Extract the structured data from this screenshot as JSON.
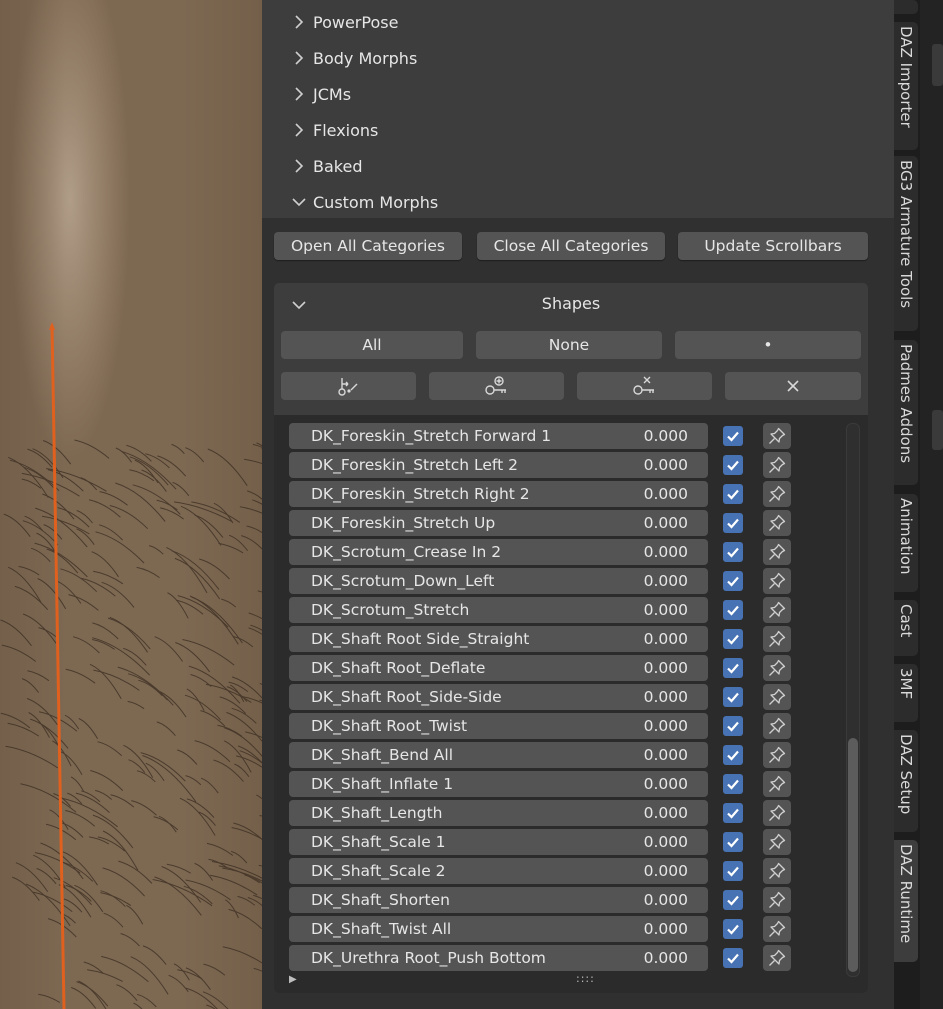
{
  "categories": [
    {
      "label": "PowerPose",
      "expanded": false
    },
    {
      "label": "Body Morphs",
      "expanded": false
    },
    {
      "label": "JCMs",
      "expanded": false
    },
    {
      "label": "Flexions",
      "expanded": false
    },
    {
      "label": "Baked",
      "expanded": false
    },
    {
      "label": "Custom Morphs",
      "expanded": true
    }
  ],
  "actions": {
    "open_all": "Open All Categories",
    "close_all": "Close All Categories",
    "update_scrollbars": "Update Scrollbars"
  },
  "shapes": {
    "title": "Shapes",
    "all_label": "All",
    "none_label": "None",
    "dot_label": "•",
    "tool_icons": [
      "add-driver-icon",
      "add-key-icon",
      "remove-key-icon",
      "clear-icon"
    ],
    "items": [
      {
        "name": "DK_Foreskin_Stretch Forward 1",
        "value": "0.000",
        "checked": true
      },
      {
        "name": "DK_Foreskin_Stretch Left 2",
        "value": "0.000",
        "checked": true
      },
      {
        "name": "DK_Foreskin_Stretch Right 2",
        "value": "0.000",
        "checked": true
      },
      {
        "name": "DK_Foreskin_Stretch Up",
        "value": "0.000",
        "checked": true
      },
      {
        "name": "DK_Scrotum_Crease In 2",
        "value": "0.000",
        "checked": true
      },
      {
        "name": "DK_Scrotum_Down_Left",
        "value": "0.000",
        "checked": true
      },
      {
        "name": "DK_Scrotum_Stretch",
        "value": "0.000",
        "checked": true
      },
      {
        "name": "DK_Shaft Root Side_Straight",
        "value": "0.000",
        "checked": true
      },
      {
        "name": "DK_Shaft Root_Deflate",
        "value": "0.000",
        "checked": true
      },
      {
        "name": "DK_Shaft Root_Side-Side",
        "value": "0.000",
        "checked": true
      },
      {
        "name": "DK_Shaft Root_Twist",
        "value": "0.000",
        "checked": true
      },
      {
        "name": "DK_Shaft_Bend All",
        "value": "0.000",
        "checked": true
      },
      {
        "name": "DK_Shaft_Inflate 1",
        "value": "0.000",
        "checked": true
      },
      {
        "name": "DK_Shaft_Length",
        "value": "0.000",
        "checked": true
      },
      {
        "name": "DK_Shaft_Scale 1",
        "value": "0.000",
        "checked": true
      },
      {
        "name": "DK_Shaft_Scale 2",
        "value": "0.000",
        "checked": true
      },
      {
        "name": "DK_Shaft_Shorten",
        "value": "0.000",
        "checked": true
      },
      {
        "name": "DK_Shaft_Twist All",
        "value": "0.000",
        "checked": true
      },
      {
        "name": "DK_Urethra Root_Push Bottom",
        "value": "0.000",
        "checked": true
      }
    ],
    "footer_grip": "::::"
  },
  "sidebar_tabs": [
    {
      "label": "DAZ Importer",
      "active": false
    },
    {
      "label": "BG3 Armature Tools",
      "active": false
    },
    {
      "label": "Padmes Addons",
      "active": false
    },
    {
      "label": "Animation",
      "active": false
    },
    {
      "label": "Cast",
      "active": false
    },
    {
      "label": "3MF",
      "active": false
    },
    {
      "label": "DAZ Setup",
      "active": false
    },
    {
      "label": "DAZ Runtime",
      "active": true
    }
  ],
  "colors": {
    "accent": "#4772b3",
    "panel_bg": "#303030",
    "widget_bg": "#545454",
    "bone_line": "#e0601e"
  }
}
